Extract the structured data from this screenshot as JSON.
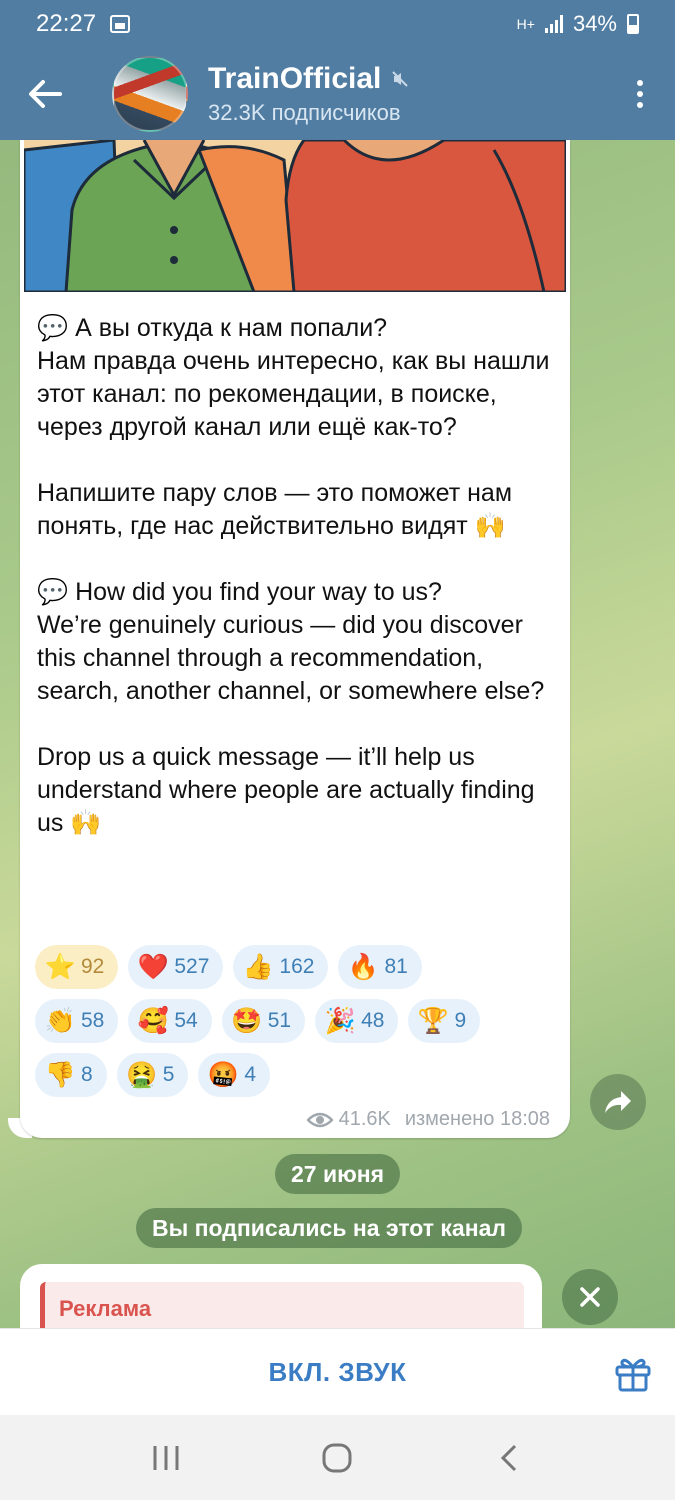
{
  "status_bar": {
    "time": "22:27",
    "network": "H+",
    "battery": "34%"
  },
  "header": {
    "channel_name": "TrainOfficial",
    "subscribers": "32.3K подписчиков",
    "muted": true
  },
  "post": {
    "text": "💬 А вы откуда к нам попали?\nНам правда очень интересно, как вы нашли этот канал: по рекомендации, в поиске, через другой канал или ещё как-то?\n\nНапишите пару слов — это поможет нам понять, где нас действительно видят 🙌\n\n💬 How did you find your way to us?\nWe’re genuinely curious — did you discover this channel through a recommendation, search, another channel, or somewhere else?\n\nDrop us a quick message — it’ll help us understand where people are actually finding us 🙌",
    "reactions": [
      {
        "emoji": "⭐",
        "count": "92",
        "active": true
      },
      {
        "emoji": "❤️",
        "count": "527"
      },
      {
        "emoji": "👍",
        "count": "162"
      },
      {
        "emoji": "🔥",
        "count": "81"
      },
      {
        "emoji": "👏",
        "count": "58"
      },
      {
        "emoji": "🥰",
        "count": "54"
      },
      {
        "emoji": "🤩",
        "count": "51"
      },
      {
        "emoji": "🎉",
        "count": "48"
      },
      {
        "emoji": "🏆",
        "count": "9"
      },
      {
        "emoji": "👎",
        "count": "8"
      },
      {
        "emoji": "🤮",
        "count": "5"
      },
      {
        "emoji": "🤬",
        "count": "4"
      }
    ],
    "views": "41.6K",
    "edited": "изменено 18:08"
  },
  "service": {
    "date": "27 июня",
    "subscribed": "Вы подписались на этот канал"
  },
  "ad": {
    "label": "Реклама"
  },
  "bottom": {
    "unmute_label": "ВКЛ. ЗВУК"
  },
  "colors": {
    "header_bg": "#517da2",
    "reaction_bg": "#e6f1fb",
    "reaction_active_bg": "#fbeec5",
    "accent": "#3b7dc4",
    "ad_accent": "#d9534f"
  }
}
